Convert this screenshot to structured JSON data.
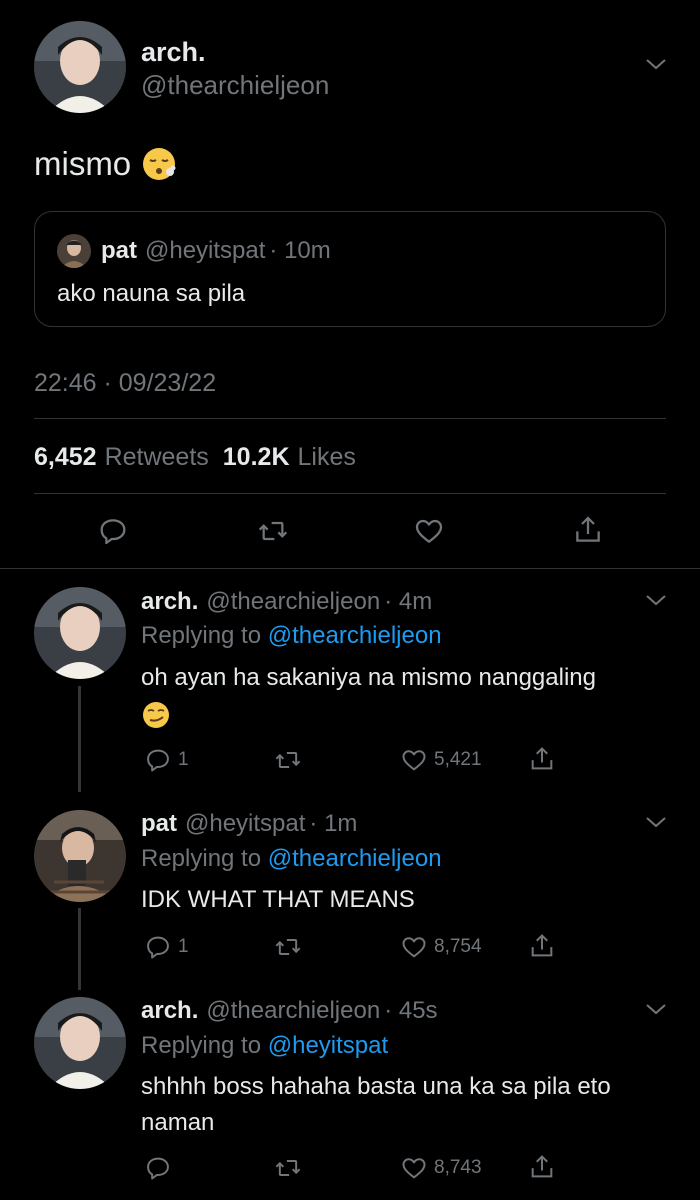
{
  "main_tweet": {
    "name": "arch.",
    "handle": "@thearchieljeon",
    "text": "mismo",
    "emoji": "face-exhaling",
    "quote": {
      "name": "pat",
      "handle": "@heyitspat",
      "time": "· 10m",
      "text": "ako nauna sa pila"
    },
    "timestamp": "22:46 · 09/23/22",
    "retweets_count": "6,452",
    "retweets_label": "Retweets",
    "likes_count": "10.2K",
    "likes_label": "Likes"
  },
  "replies": [
    {
      "name": "arch.",
      "handle": "@thearchieljeon",
      "time": "· 4m",
      "replying_prefix": "Replying to",
      "replying_to": "@thearchieljeon",
      "text": "oh ayan ha sakaniya na mismo nanggaling",
      "emoji": "smirking-face",
      "reply_count": "1",
      "like_count": "5,421"
    },
    {
      "name": "pat",
      "handle": "@heyitspat",
      "time": "· 1m",
      "replying_prefix": "Replying to",
      "replying_to": "@thearchieljeon",
      "text": "IDK WHAT THAT MEANS",
      "reply_count": "1",
      "like_count": "8,754"
    },
    {
      "name": "arch.",
      "handle": "@thearchieljeon",
      "time": "· 45s",
      "replying_prefix": "Replying to",
      "replying_to": "@heyitspat",
      "text": "shhhh boss hahaha basta una ka sa pila eto naman",
      "reply_count": "",
      "like_count": "8,743"
    }
  ],
  "colors": {
    "background": "#000000",
    "text": "#e7e9ea",
    "secondary": "#71767b",
    "link": "#1d9bf0",
    "divider": "#2f3336"
  },
  "icons": [
    "reply-icon",
    "retweet-icon",
    "like-icon",
    "share-icon",
    "chevron-down-icon"
  ]
}
